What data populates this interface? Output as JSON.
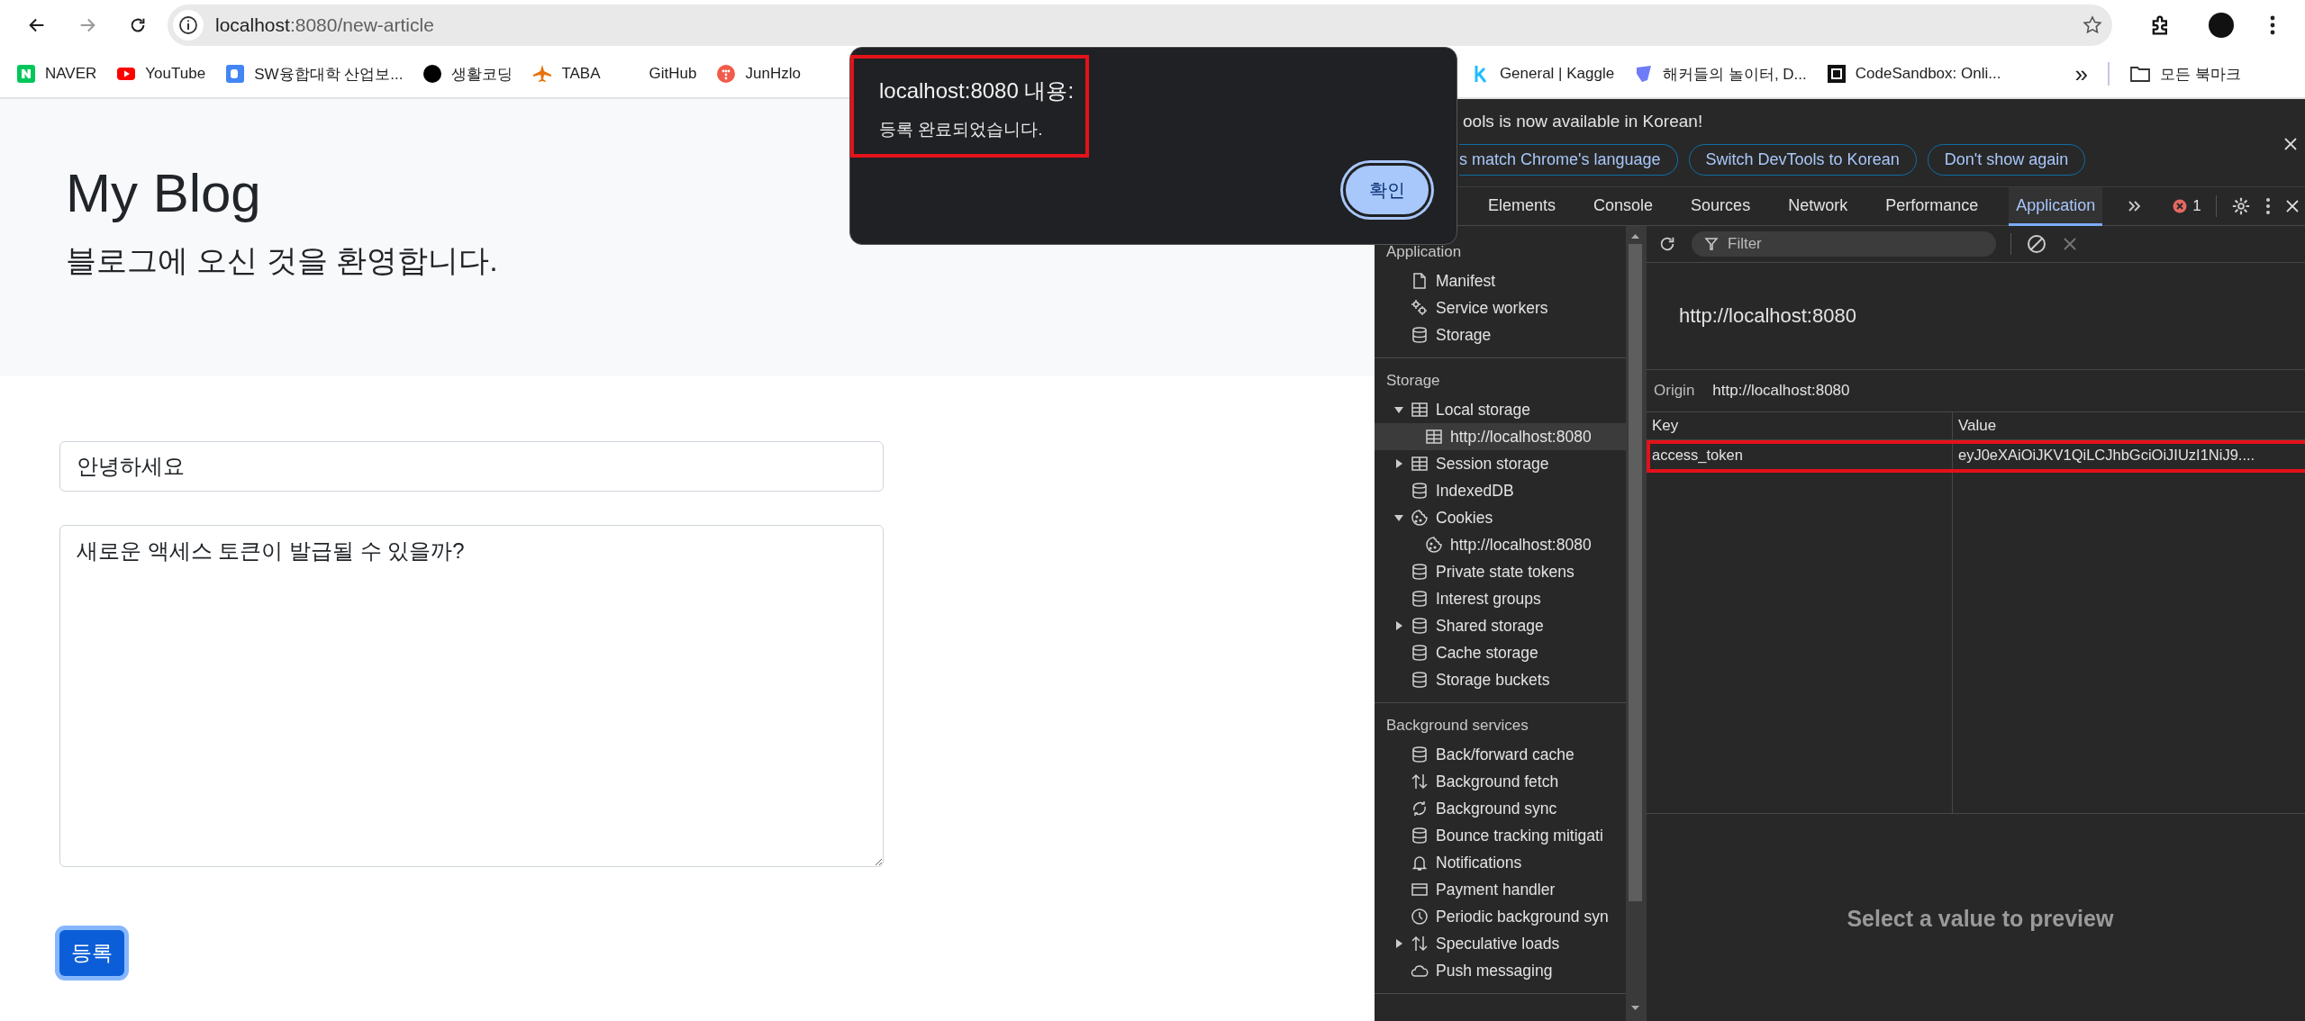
{
  "browser": {
    "nav": [
      {
        "kind": "back",
        "disabled": false
      },
      {
        "kind": "forward",
        "disabled": true
      },
      {
        "kind": "reload",
        "disabled": false
      }
    ],
    "address": {
      "host": "localhost",
      "path": ":8080/new-article"
    },
    "bookmarks": [
      {
        "label": "NAVER",
        "kind": "naver"
      },
      {
        "label": "YouTube",
        "kind": "play"
      },
      {
        "label": "SW융합대학 산업보...",
        "kind": "doc"
      },
      {
        "label": "생활코딩",
        "kind": "dot"
      },
      {
        "label": "TABA",
        "kind": "plane"
      },
      {
        "label": "GitHub",
        "kind": "blank"
      },
      {
        "label": "JunHzlo",
        "kind": "coral"
      }
    ],
    "bookmarks_right": [
      {
        "label": "General | Kaggle",
        "kind": "kaggle"
      },
      {
        "label": "해커들의 놀이터, D...",
        "kind": "shield"
      },
      {
        "label": "CodeSandbox: Onli...",
        "kind": "square"
      }
    ],
    "more_bookmarks": "»",
    "all_bookmarks": "모든 북마크"
  },
  "page": {
    "title": "My Blog",
    "subtitle": "블로그에 오신 것을 환영합니다.",
    "title_value": "안녕하세요",
    "content_value": "새로운 액세스 토큰이 발급될 수 있을까?",
    "submit": "등록"
  },
  "dialog": {
    "title": "localhost:8080 내용:",
    "message": "등록 완료되었습니다.",
    "ok": "확인"
  },
  "devtools": {
    "banner": {
      "message": "ools is now available in Korean!",
      "buttons": [
        "s match Chrome's language",
        "Switch DevTools to Korean",
        "Don't show again"
      ]
    },
    "tabs": [
      {
        "label": "Elements",
        "selected": false
      },
      {
        "label": "Console",
        "selected": false
      },
      {
        "label": "Sources",
        "selected": false
      },
      {
        "label": "Network",
        "selected": false
      },
      {
        "label": "Performance",
        "selected": false
      },
      {
        "label": "Application",
        "selected": true
      }
    ],
    "error_count": "1",
    "sections": [
      {
        "heading": "Application",
        "items": [
          {
            "label": "Manifest",
            "kind": "file",
            "selected": false
          },
          {
            "label": "Service workers",
            "kind": "gears",
            "selected": false
          },
          {
            "label": "Storage",
            "kind": "database",
            "selected": false
          }
        ]
      },
      {
        "heading": "Storage",
        "items": [
          {
            "label": "Local storage",
            "kind": "table",
            "expanded": true,
            "selected": false,
            "children": [
              {
                "label": "http://localhost:8080",
                "kind": "table",
                "selected": true
              }
            ]
          },
          {
            "label": "Session storage",
            "kind": "table",
            "expanded": false,
            "selected": false
          },
          {
            "label": "IndexedDB",
            "kind": "database",
            "selected": false
          },
          {
            "label": "Cookies",
            "kind": "cookie",
            "expanded": true,
            "selected": false,
            "children": [
              {
                "label": "http://localhost:8080",
                "kind": "cookie",
                "selected": false
              }
            ]
          },
          {
            "label": "Private state tokens",
            "kind": "database",
            "selected": false
          },
          {
            "label": "Interest groups",
            "kind": "database",
            "selected": false
          },
          {
            "label": "Shared storage",
            "kind": "database",
            "expanded": false,
            "selected": false
          },
          {
            "label": "Cache storage",
            "kind": "database",
            "selected": false
          },
          {
            "label": "Storage buckets",
            "kind": "database",
            "selected": false
          }
        ]
      },
      {
        "heading": "Background services",
        "items": [
          {
            "label": "Back/forward cache",
            "kind": "database",
            "selected": false
          },
          {
            "label": "Background fetch",
            "kind": "arrows",
            "selected": false
          },
          {
            "label": "Background sync",
            "kind": "sync",
            "selected": false
          },
          {
            "label": "Bounce tracking mitigati",
            "kind": "database",
            "selected": false
          },
          {
            "label": "Notifications",
            "kind": "bell",
            "selected": false
          },
          {
            "label": "Payment handler",
            "kind": "card",
            "selected": false
          },
          {
            "label": "Periodic background syn",
            "kind": "clock",
            "selected": false
          },
          {
            "label": "Speculative loads",
            "kind": "arrows",
            "expanded": false,
            "selected": false
          },
          {
            "label": "Push messaging",
            "kind": "cloud",
            "selected": false
          }
        ]
      }
    ],
    "filter": {
      "placeholder": "Filter"
    },
    "origin_title": "http://localhost:8080",
    "origin": {
      "label": "Origin",
      "value": "http://localhost:8080"
    },
    "table": {
      "columns": [
        "Key",
        "Value"
      ],
      "rows": [
        {
          "key": "access_token",
          "value": "eyJ0eXAiOiJKV1QiLCJhbGciOiJIUzI1NiJ9....",
          "highlighted": true
        }
      ]
    },
    "preview": "Select a value to preview"
  }
}
